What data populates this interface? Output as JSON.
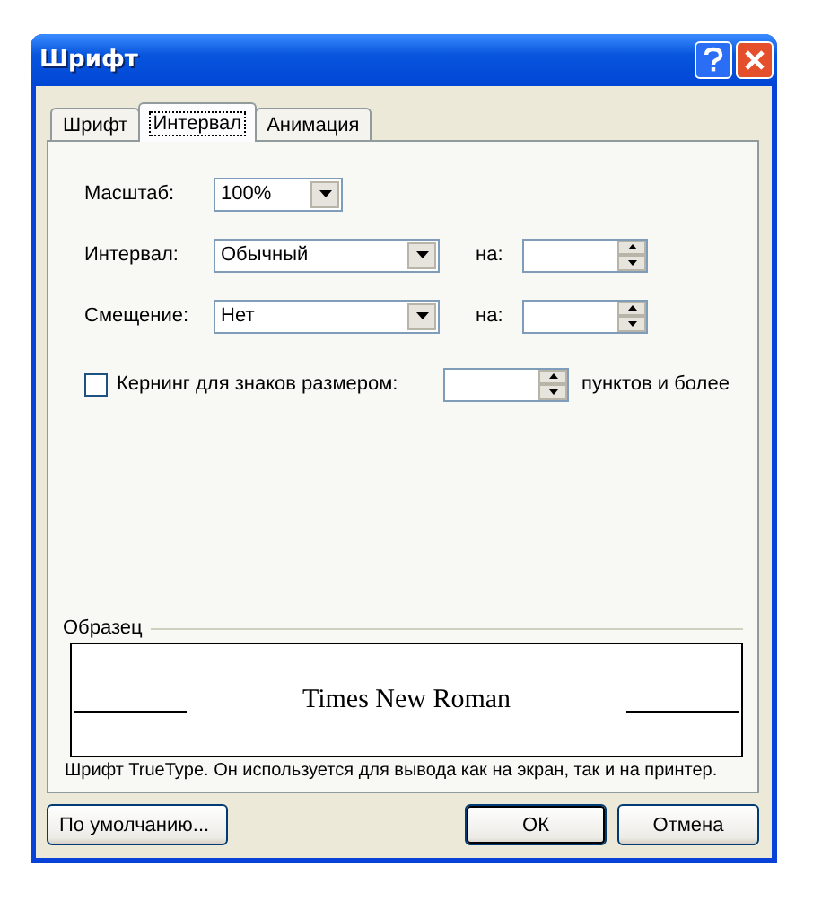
{
  "window": {
    "title": "Шрифт"
  },
  "tabs": [
    {
      "label": "Шрифт",
      "selected": false
    },
    {
      "label": "Интервал",
      "selected": true
    },
    {
      "label": "Анимация",
      "selected": false
    }
  ],
  "rows": [
    {
      "kind": "combo",
      "label": "Масштаб:",
      "value": "100%"
    },
    {
      "kind": "combo-spin",
      "label": "Интервал:",
      "value": "Обычный",
      "spin_label": "на:"
    },
    {
      "kind": "combo-spin",
      "label": "Смещение:",
      "value": "Нет",
      "spin_label": "на:"
    },
    {
      "kind": "check-spin",
      "label": "Кернинг для знаков размером:",
      "checked": false,
      "suffix": "пунктов и более"
    }
  ],
  "preview": {
    "group_label": "Образец",
    "sample": "Times New Roman",
    "note": "Шрифт TrueType. Он используется для вывода как на экран, так и на принтер."
  },
  "buttons": [
    {
      "label": "По умолчанию...",
      "kind": "left"
    },
    {
      "label": "ОК",
      "kind": "default"
    },
    {
      "label": "Отмена",
      "kind": "normal"
    }
  ]
}
